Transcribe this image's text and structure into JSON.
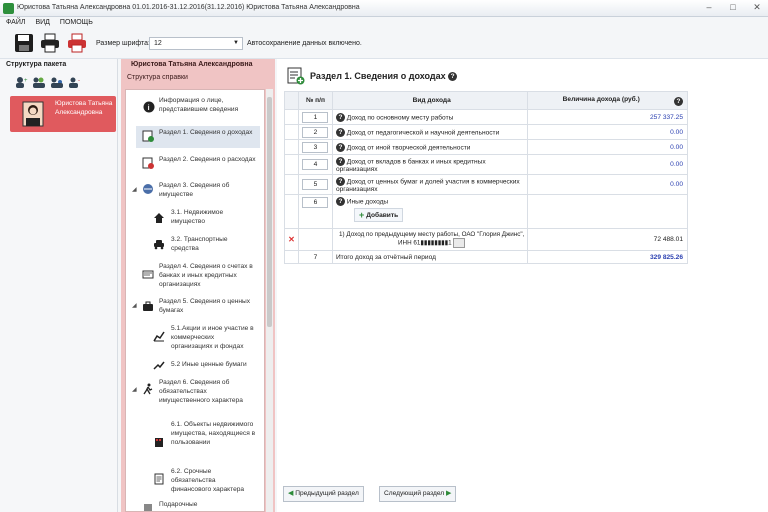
{
  "window": {
    "title": "Юристова Татьяна Александровна 01.01.2016-31.12.2016(31.12.2016) Юристова Татьяна Александровна"
  },
  "menu": [
    "ФАЙЛ",
    "ВИД",
    "ПОМОЩЬ"
  ],
  "toolbar": {
    "font_label": "Размер шрифта:",
    "font_value": "12",
    "autosave": "Автосохранение данных включено."
  },
  "left_panel": {
    "title": "Структура пакета",
    "person_name": "Юристова Татьяна Александровна"
  },
  "nav_panel": {
    "header": "Юристова Татьяна Александровна",
    "subtitle": "Структура справки",
    "items": [
      {
        "label": "Информация о лице, представившем сведения",
        "icon": "info-icon"
      },
      {
        "label": "Раздел 1. Сведения о доходах",
        "icon": "income-icon",
        "selected": true
      },
      {
        "label": "Раздел 2. Сведения о расходах",
        "icon": "expenses-icon"
      },
      {
        "label": "Раздел 3. Сведения об имуществе",
        "icon": "property-icon"
      },
      {
        "label": "3.1. Недвижимое имущество",
        "icon": "house-icon"
      },
      {
        "label": "3.2. Транспортные средства",
        "icon": "car-icon"
      },
      {
        "label": "Раздел 4. Сведения о счетах в банках и иных кредитных организациях",
        "icon": "bank-icon"
      },
      {
        "label": "Раздел 5. Сведения о ценных бумагах",
        "icon": "briefcase-icon"
      },
      {
        "label": "5.1.Акции и иное участие в коммерческих организациях и фондах",
        "icon": "chart-icon"
      },
      {
        "label": "5.2 Иные ценные бумаги",
        "icon": "securities-icon"
      },
      {
        "label": "Раздел 6. Сведения об обязательствах имущественного характера",
        "icon": "running-icon"
      },
      {
        "label": "6.1. Объекты недвижимого имущества, находящиеся в пользовании",
        "icon": "building-icon"
      },
      {
        "label": "6.2. Срочные обязательства финансового характера",
        "icon": "document-icon"
      },
      {
        "label": "Подарочные",
        "icon": "gift-icon"
      }
    ]
  },
  "main": {
    "title": "Раздел 1. Сведения о доходах",
    "columns": {
      "no": "№ п/п",
      "kind": "Вид дохода",
      "value": "Величина дохода (руб.)"
    },
    "rows": [
      {
        "no": "1",
        "kind": "Доход по основному месту работы",
        "value": "257 337.25"
      },
      {
        "no": "2",
        "kind": "Доход от педагогической и научной деятельности",
        "value": "0.00"
      },
      {
        "no": "3",
        "kind": "Доход от иной творческой деятельности",
        "value": "0.00"
      },
      {
        "no": "4",
        "kind": "Доход от вкладов в банках и иных кредитных организациях",
        "value": "0.00"
      },
      {
        "no": "5",
        "kind": "Доход от ценных бумаг и долей участия в коммерческих организациях",
        "value": "0.00"
      },
      {
        "no": "6",
        "kind": "Иные доходы",
        "value": ""
      }
    ],
    "add_label": "Добавить",
    "sub_row": {
      "text": "1) Доход по предыдущему месту работы, ОАО \"Глория Джинс\", ИНН 61▮▮▮▮▮▮▮▮1",
      "value": "72 488.01"
    },
    "total": {
      "no": "7",
      "kind": "Итого доход за отчётный период",
      "value": "329 825.26"
    },
    "prev_button": "Предыдущий раздел",
    "next_button": "Следующий раздел"
  },
  "colors": {
    "accent_red": "#e05a5e",
    "nav_bg": "#f0c4c4",
    "value_blue": "#2a3fb0",
    "add_green": "#2e8b3a"
  }
}
